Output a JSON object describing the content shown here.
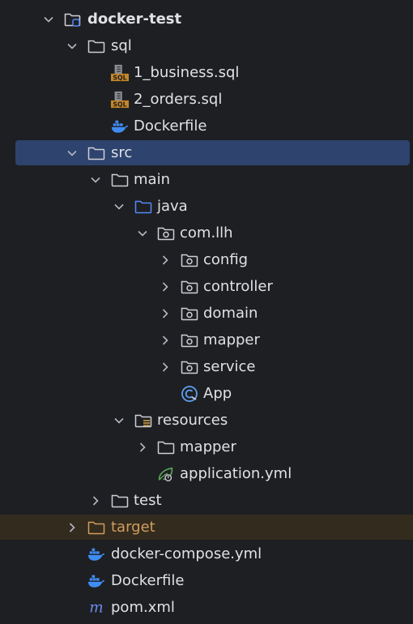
{
  "colors": {
    "background": "#1e1f22",
    "selection": "#2e436e",
    "excluded_bg": "#332b1e",
    "text": "#dfe1e5",
    "excluded_text": "#d19d5e",
    "java_folder": "#548af7",
    "docker": "#3f8cf2",
    "sql_badge": "#c4862a",
    "app_icon": "#5f9ff0",
    "maven": "#6c8cf0"
  },
  "tree": [
    {
      "name": "docker-test"
    },
    {
      "name": "sql"
    },
    {
      "name": "1_business.sql",
      "badge": "SQL"
    },
    {
      "name": "2_orders.sql",
      "badge": "SQL"
    },
    {
      "name": "Dockerfile"
    },
    {
      "name": "src"
    },
    {
      "name": "main"
    },
    {
      "name": "java"
    },
    {
      "name": "com.llh"
    },
    {
      "name": "config"
    },
    {
      "name": "controller"
    },
    {
      "name": "domain"
    },
    {
      "name": "mapper"
    },
    {
      "name": "service"
    },
    {
      "name": "App"
    },
    {
      "name": "resources"
    },
    {
      "name": "mapper"
    },
    {
      "name": "application.yml"
    },
    {
      "name": "test"
    },
    {
      "name": "target"
    },
    {
      "name": "docker-compose.yml"
    },
    {
      "name": "Dockerfile"
    },
    {
      "name": "pom.xml"
    }
  ]
}
